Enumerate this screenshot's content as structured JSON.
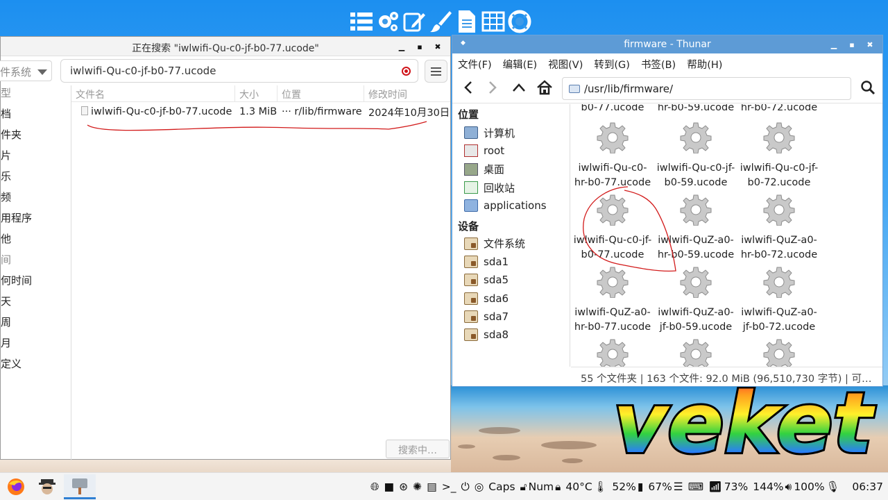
{
  "search_window": {
    "title": "正在搜索 \"iwlwifi-Qu-c0-jf-b0-77.ucode\"",
    "location_combo": "件系统",
    "query": "iwlwifi-Qu-c0-jf-b0-77.ucode",
    "sidebar": [
      "类型",
      "文档",
      "文件夹",
      "图片",
      "音乐",
      "视频",
      "应用程序",
      "其他",
      "时间",
      "任何时间",
      "今天",
      "本周",
      "本月",
      "自定义"
    ],
    "columns": [
      "文件名",
      "大小",
      "位置",
      "修改时间"
    ],
    "result": {
      "name": "iwlwifi-Qu-c0-jf-b0-77.ucode",
      "size": "1.3 MiB",
      "location": "··· r/lib/firmware",
      "modified": "2024年10月30日"
    },
    "status_button": "搜索中…"
  },
  "thunar": {
    "title": "firmware - Thunar",
    "menu": [
      "文件(F)",
      "编辑(E)",
      "视图(V)",
      "转到(G)",
      "书签(B)",
      "帮助(H)"
    ],
    "address": "/usr/lib/firmware/",
    "places_header": "位置",
    "places": [
      "计算机",
      "root",
      "桌面",
      "回收站",
      "applications"
    ],
    "devices_header": "设备",
    "devices": [
      "文件系统",
      "sda1",
      "sda5",
      "sda6",
      "sda7",
      "sda8"
    ],
    "top_partial": [
      [
        "b0-77.ucode"
      ],
      [
        "hr-b0-59.ucode"
      ],
      [
        "hr-b0-72.ucode"
      ]
    ],
    "files": [
      [
        "iwlwifi-Qu-c0-",
        "hr-b0-77.ucode"
      ],
      [
        "iwlwifi-Qu-c0-jf-",
        "b0-59.ucode"
      ],
      [
        "iwlwifi-Qu-c0-jf-",
        "b0-72.ucode"
      ],
      [
        "iwlwifi-Qu-c0-jf-",
        "b0-77.ucode"
      ],
      [
        "iwlwifi-QuZ-a0-",
        "hr-b0-59.ucode"
      ],
      [
        "iwlwifi-QuZ-a0-",
        "hr-b0-72.ucode"
      ],
      [
        "iwlwifi-QuZ-a0-",
        "hr-b0-77.ucode"
      ],
      [
        "iwlwifi-QuZ-a0-",
        "jf-b0-59.ucode"
      ],
      [
        "iwlwifi-QuZ-a0-",
        "jf-b0-72.ucode"
      ]
    ],
    "status": "55 个文件夹 | 163 个文件: 92.0 MiB (96,510,730 字节) | 可…"
  },
  "desktop": {
    "logo_text": "veket"
  },
  "taskbar": {
    "caps": "Caps",
    "num": "Num",
    "temp": "40°C",
    "battery1": "52%",
    "mem": "67%",
    "wifi": "73%",
    "zoom": "144%",
    "volume": "100%",
    "clock": "06:37"
  }
}
